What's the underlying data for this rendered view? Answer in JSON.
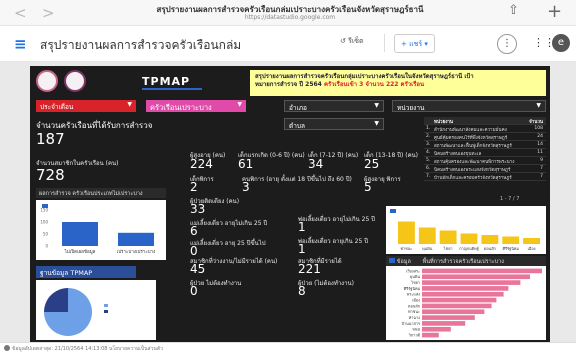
{
  "browser": {
    "title": "สรุปรายงานผลการสำรวจครัวเรือนกล่มเปราะบางครัวเรือนจังหวัดสุราษฎร์ธานี",
    "url": "https://datastudio.google.com",
    "back": "<",
    "forward": ">",
    "share_icon": "share-icon",
    "plus": "+"
  },
  "app": {
    "menu_icon": "≡",
    "title": "สรุปรายงานผลการสำรวจครัวเรือนกล่ม",
    "reset_label": "รีเซ็ต",
    "share_label": "แชร์",
    "more": "⋮",
    "apps": "⋮⋮",
    "account": "e"
  },
  "report": {
    "logo_text": "TPMAP",
    "banner_line1": "สรุปรายงานผลการสำรวจครัวเรือนกลุ่มเปราะบางครัวเรือนในจังหวัดสุราษฎร์ธานี เป้า",
    "banner_line2_prefix": "หมายการสำรวจ ปี 2564",
    "banner_line2_red": "ครัวเรือนเข้า 3 จำนวน 222 ครัวเรือน",
    "filters": {
      "f1": "ประจำเดือน",
      "f2": "ครัวเรือนเปราะบาง",
      "f3": "อำเภอ",
      "f4": "หน่วยงาน",
      "f5": "ตำบล"
    },
    "households_label": "จำนวนครัวเรือนที่ได้รับการสำรวจ",
    "households_value": "187",
    "members_label": "จำนวนสมาชิกในครัวเรือน (คน)",
    "members_value": "728",
    "stats": [
      {
        "label": "ผู้สูงอายุ (คน)",
        "value": "224"
      },
      {
        "label": "เด็กแรกเกิด (0-6 ปี) (คน)",
        "value": "61"
      },
      {
        "label": "เด็ก (7-12 ปี) (คน)",
        "value": "34"
      },
      {
        "label": "เด็ก (13-18 ปี) (คน)",
        "value": "25"
      },
      {
        "label": "เด็กพิการ",
        "value": "2"
      },
      {
        "label": "คนพิการ (อายุ ตั้งแต่ 18 ปีขึ้นไป ถึง 60 ปี)",
        "value": "3"
      },
      {
        "label": "ผู้สูงอายุ พิการ",
        "value": "5"
      },
      {
        "label": "ผู้ป่วยติดเตียง (คน)",
        "value": "33"
      },
      {
        "label": "แม่เลี้ยงเดี่ยว อายุไม่เกิน 25 ปี",
        "value": "6"
      },
      {
        "label": "พ่อเลี้ยงเดี่ยว อายุไม่เกิน 25 ปี",
        "value": "1"
      },
      {
        "label": "แม่เลี้ยงเดี่ยว อายุ 25 ปีขึ้นไป",
        "value": "0"
      },
      {
        "label": "พ่อเลี้ยงเดี่ยว อายุเกิน 25 ปี",
        "value": "1"
      },
      {
        "label": "สมาชิกที่ว่างงาน/ไม่มีรายได้ (คน)",
        "value": "45"
      },
      {
        "label": "สมาชิกที่มีรายได้",
        "value": "221"
      },
      {
        "label": "ผู้ป่วย ไม่ต้องทำงาน",
        "value": "0"
      },
      {
        "label": "ผู้ป่วย (ไม่ต้องทำงาน)",
        "value": "8"
      }
    ],
    "table": {
      "head": [
        "",
        "หน่วยงาน",
        "จำนวน"
      ],
      "rows": [
        [
          "1.",
          "สำนักงานพัฒนาสังคมและความมั่นคง",
          "108"
        ],
        [
          "2.",
          "ศูนย์คุ้มครองคนไร้ที่พึ่งจังหวัดสุราษฎร์",
          "24"
        ],
        [
          "3.",
          "สถานพัฒนาและฟื้นฟูเด็กจังหวัดสุราษฎร์",
          "14"
        ],
        [
          "4.",
          "นิคมสร้างตนเองขุนทะเล",
          "11"
        ],
        [
          "5.",
          "สถานคุ้มครองและพัฒนาคนพิการพระนาง",
          "9"
        ],
        [
          "6.",
          "นิคมสร้างตนเองพระแสงจังหวัดสุราษฎร์",
          "7"
        ],
        [
          "7.",
          "บ้านพักเด็กและครอบครัวจังหวัดสุราษฎร์",
          "7"
        ]
      ],
      "pager": "1 - 7 / 7"
    },
    "left_chart_title": "ผลการสำรวจ ครัวเรือนประเภทไม่เปราะบาง",
    "tpmap_header": "ฐานข้อมูล TPMAP",
    "right_chart_legend": "ข้อมูล",
    "right_chart_title": "พื้นที่การสำรวจครัวเรือนเปราะบาง",
    "footer": "ข้อมูลอัปเดตล่าสุด: 21/10/2564 14:13:08   นโยบายความเป็นส่วนตัว"
  },
  "colors": {
    "accent": "#1a73e8",
    "dark_bg": "#1c1c1c",
    "red_filter": "#d8232a",
    "pink_filter": "#e04aa8",
    "blue_bar": "#2a64c8",
    "yellow_bar": "#f5c518",
    "pink_bar": "#e8759a"
  },
  "chart_data": [
    {
      "type": "bar",
      "title": "ผลการสำรวจ ครัวเรือนประเภทไม่เปราะบาง",
      "categories": [
        "ไม่เปิดเผยข้อมูล",
        "เปราะบางเปราะบาง"
      ],
      "values": [
        100,
        55
      ],
      "ylim": [
        0,
        150
      ]
    },
    {
      "type": "bar",
      "categories": [
        "ท่าชนะ",
        "พุนพิน",
        "ไชยา",
        "กาญจนดิษฐ์",
        "ดอนสัก",
        "คีรีรัฐนิคม",
        "เมือง"
      ],
      "values": [
        15,
        11,
        9,
        7,
        6,
        5,
        4
      ],
      "ylim": [
        0,
        20
      ]
    },
    {
      "type": "pie",
      "values": [
        75,
        25
      ]
    },
    {
      "type": "bar",
      "title": "พื้นที่การสำรวจครัวเรือนเปราะบาง",
      "categories": [
        "เวียงสระ",
        "พุนพิน",
        "ไชยา",
        "คีรีรัฐนิคม",
        "พระแสง",
        "เมือง",
        "ดอนสัก",
        "ท่าชนะ",
        "ท่าฉาง",
        "บ้านนาสาร",
        "พนม",
        "วิภาวดี"
      ],
      "values": [
        50,
        45,
        41,
        36,
        34,
        31,
        29,
        26,
        22,
        18,
        12,
        7
      ],
      "orientation": "horizontal"
    }
  ]
}
